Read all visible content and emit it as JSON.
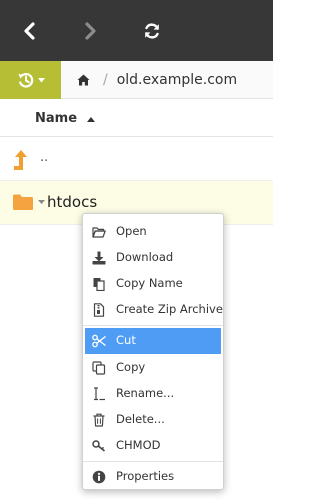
{
  "toolbar": {
    "back_icon": "chevron-left-icon",
    "forward_icon": "chevron-right-icon",
    "refresh_icon": "refresh-icon",
    "background": "#373737"
  },
  "pathbar": {
    "history_icon": "history-icon",
    "home_icon": "home-icon",
    "separator": "/",
    "path": "old.example.com",
    "accent": "#b5be34"
  },
  "list": {
    "header_name": "Name",
    "sort": "ascending",
    "rows": [
      {
        "name": "..",
        "type": "parent",
        "icon": "level-up-icon"
      },
      {
        "name": "htdocs",
        "type": "folder",
        "icon": "folder-icon"
      }
    ]
  },
  "context_menu": {
    "items": [
      {
        "label": "Open",
        "icon": "folder-open-icon"
      },
      {
        "label": "Download",
        "icon": "download-icon"
      },
      {
        "label": "Copy Name",
        "icon": "copy-name-icon"
      },
      {
        "label": "Create Zip Archive",
        "icon": "zip-archive-icon"
      },
      {
        "label": "Cut",
        "icon": "scissors-icon",
        "active": true
      },
      {
        "label": "Copy",
        "icon": "copy-icon"
      },
      {
        "label": "Rename...",
        "icon": "text-cursor-icon"
      },
      {
        "label": "Delete...",
        "icon": "trash-icon"
      },
      {
        "label": "CHMOD",
        "icon": "key-icon"
      },
      {
        "label": "Properties",
        "icon": "info-icon"
      }
    ],
    "highlight_color": "#4f9cf5"
  }
}
